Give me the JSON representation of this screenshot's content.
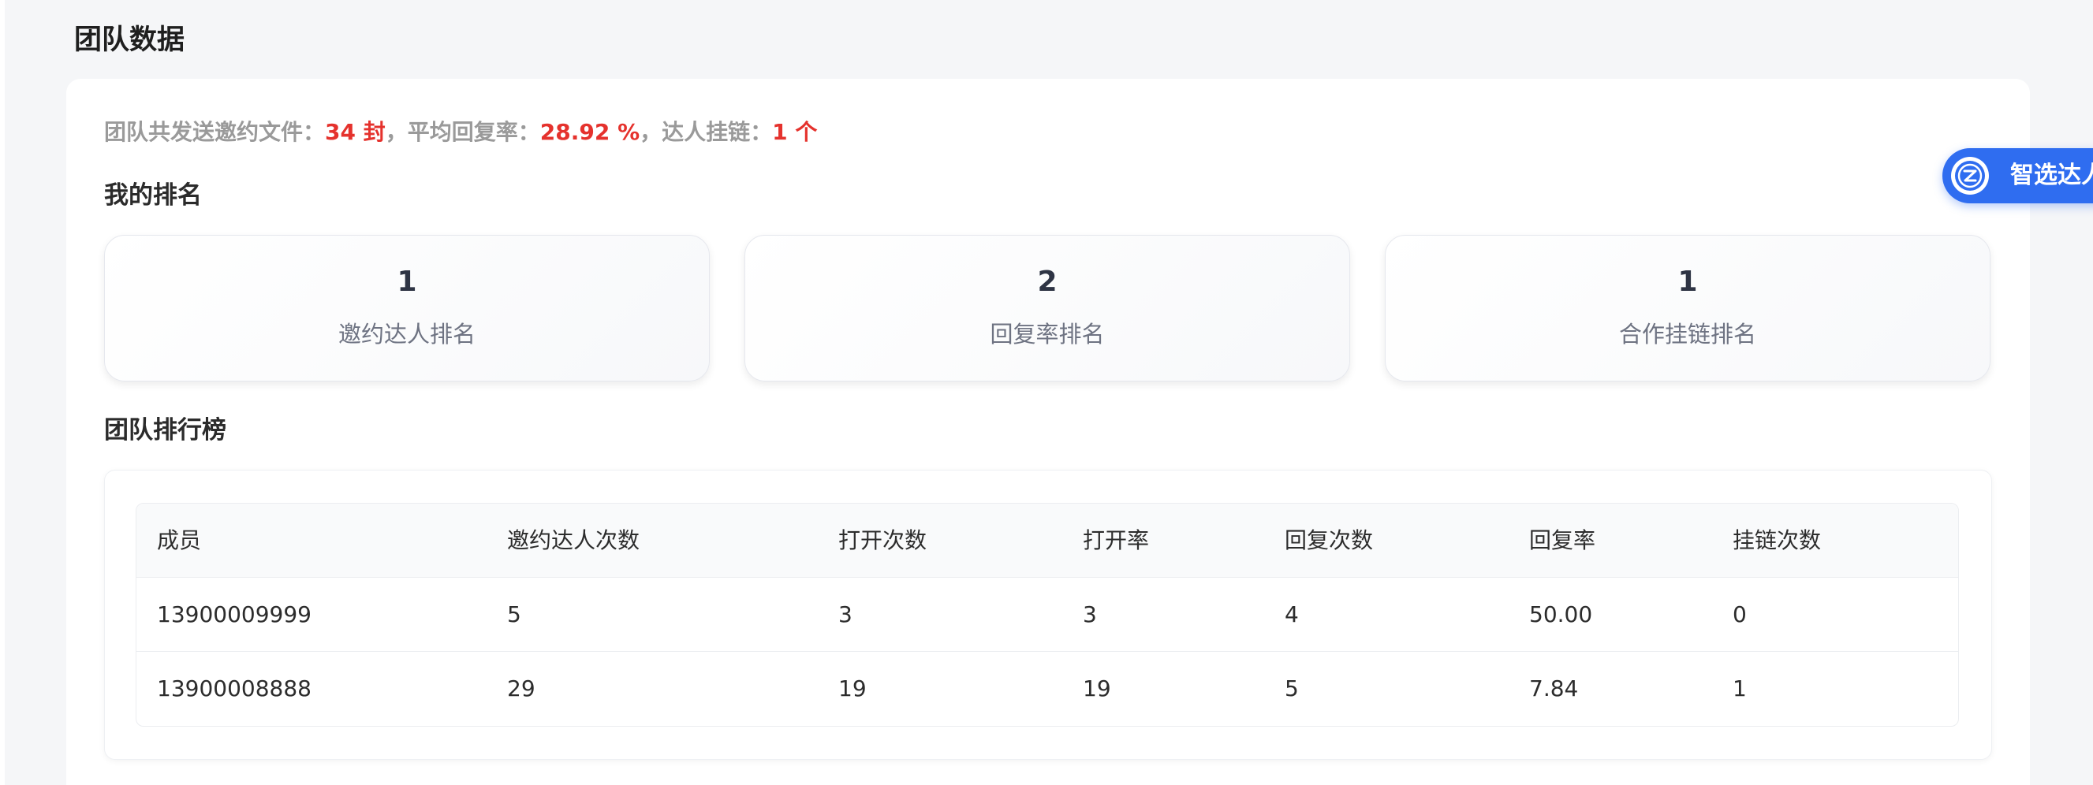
{
  "page_title": "团队数据",
  "summary": {
    "prefix": "团队共发送邀约文件：",
    "files_count": "34 封",
    "mid1": "，平均回复率：",
    "avg_reply_rate": "28.92 %",
    "mid2": "，达人挂链：",
    "linked_count": "1 个"
  },
  "my_ranking": {
    "title": "我的排名",
    "cards": [
      {
        "value": "1",
        "label": "邀约达人排名"
      },
      {
        "value": "2",
        "label": "回复率排名"
      },
      {
        "value": "1",
        "label": "合作挂链排名"
      }
    ]
  },
  "leaderboard": {
    "title": "团队排行榜",
    "columns": [
      "成员",
      "邀约达人次数",
      "打开次数",
      "打开率",
      "回复次数",
      "回复率",
      "挂链次数"
    ],
    "rows": [
      [
        "13900009999",
        "5",
        "3",
        "3",
        "4",
        "50.00",
        "0"
      ],
      [
        "13900008888",
        "29",
        "19",
        "19",
        "5",
        "7.84",
        "1"
      ]
    ]
  },
  "floating_button": {
    "label": "智选达人",
    "icon": "zhixuan-logo-icon"
  },
  "colors": {
    "highlight": "#e5322d",
    "accent": "#2f6df0"
  }
}
